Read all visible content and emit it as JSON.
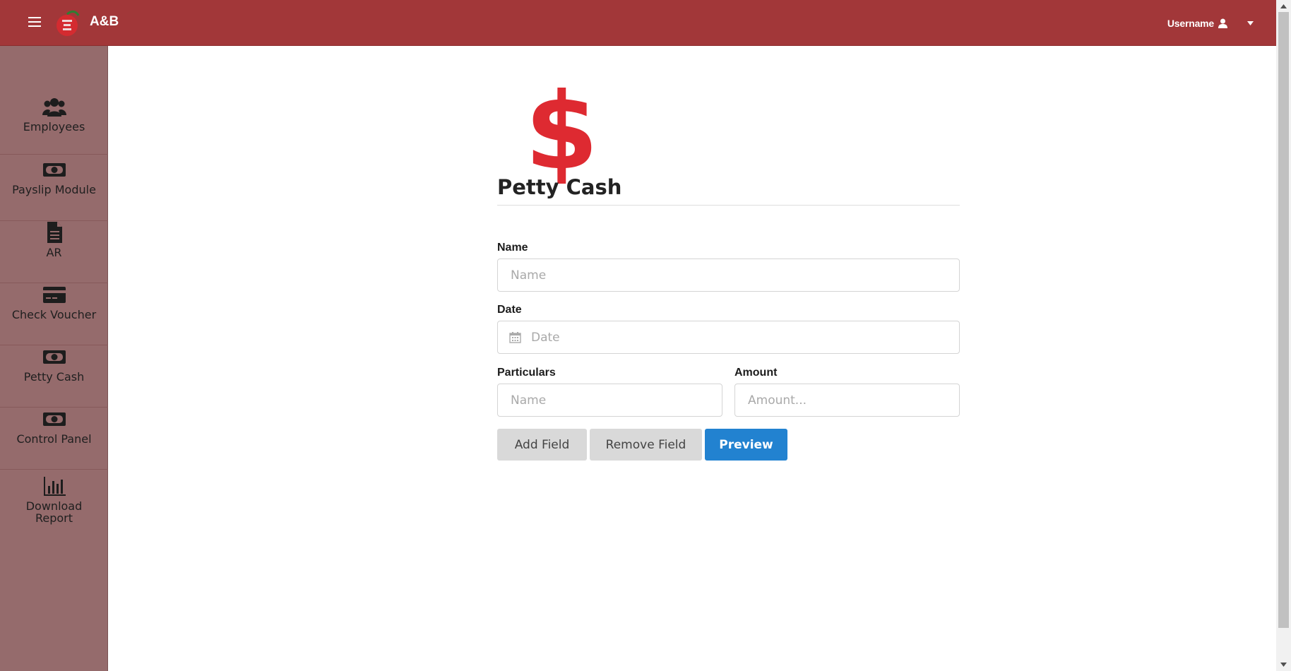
{
  "header": {
    "brand": "A&B",
    "username": "Username",
    "logo_icon": "apple-logo",
    "menu_icon": "hamburger-icon",
    "user_icon": "user-icon",
    "caret_icon": "caret-down-icon",
    "bar_color": "#a23739"
  },
  "sidebar": {
    "bg_color": "#956b6c",
    "items": [
      {
        "label": "Employees",
        "icon": "users-icon"
      },
      {
        "label": "Payslip Module",
        "icon": "money-bill-icon"
      },
      {
        "label": "AR",
        "icon": "file-icon"
      },
      {
        "label": "Check Voucher",
        "icon": "credit-card-icon"
      },
      {
        "label": "Petty Cash",
        "icon": "money-bill-icon"
      },
      {
        "label": "Control Panel",
        "icon": "money-bill-icon"
      },
      {
        "label": "Download Report",
        "icon": "bar-chart-icon"
      }
    ]
  },
  "main": {
    "hero_symbol": "$",
    "hero_color": "#de2a31",
    "title": "Petty Cash",
    "form": {
      "name_label": "Name",
      "name_placeholder": "Name",
      "date_label": "Date",
      "date_placeholder": "Date",
      "particulars_label": "Particulars",
      "particulars_placeholder": "Name",
      "amount_label": "Amount",
      "amount_placeholder": "Amount..."
    },
    "buttons": {
      "add_field": "Add Field",
      "remove_field": "Remove Field",
      "preview": "Preview"
    },
    "accent_color": "#2282d0"
  }
}
